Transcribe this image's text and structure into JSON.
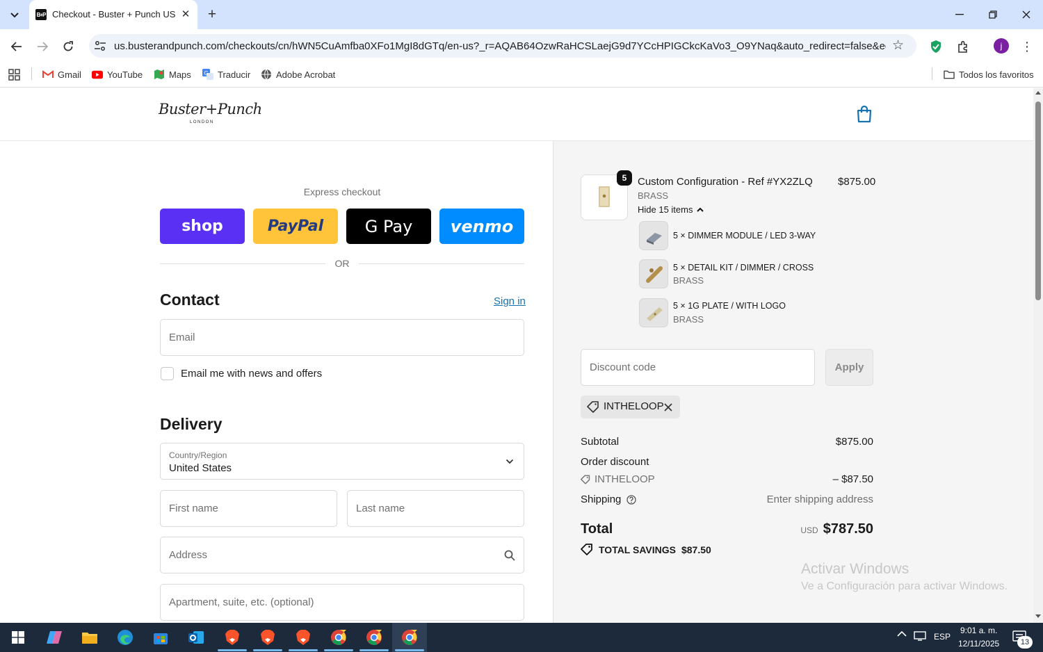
{
  "browser": {
    "tab_title": "Checkout - Buster + Punch US",
    "tab_favicon": "B+P",
    "url": "us.busterandpunch.com/checkouts/cn/hWN5CuAmfba0XFo1MgI8dGTq/en-us?_r=AQAB64OzwRaHCSLaejG9d7YCcHPIGCkcKaVo3_O9YNaq&auto_redirect=false&edge_red...",
    "profile_initial": "j",
    "bookmarks": [
      "Gmail",
      "YouTube",
      "Maps",
      "Traducir",
      "Adobe Acrobat"
    ],
    "all_bookmarks": "Todos los favoritos"
  },
  "brand": {
    "logo_text": "Buster+Punch",
    "logo_sub": "LONDON"
  },
  "checkout": {
    "express_title": "Express checkout",
    "express_buttons": [
      "shop",
      "PayPal",
      "G Pay",
      "venmo"
    ],
    "or": "OR",
    "contact_title": "Contact",
    "sign_in": "Sign in",
    "email_placeholder": "Email",
    "news_label": "Email me with news and offers",
    "delivery_title": "Delivery",
    "country_label": "Country/Region",
    "country_value": "United States",
    "first_name_placeholder": "First name",
    "last_name_placeholder": "Last name",
    "address_placeholder": "Address",
    "apartment_placeholder": "Apartment, suite, etc. (optional)"
  },
  "summary": {
    "item_qty": "5",
    "item_title": "Custom Configuration - Ref #YX2ZLQ",
    "item_sub": "BRASS",
    "item_price": "$875.00",
    "hide_items": "Hide 15 items",
    "components": [
      {
        "label": "5 × DIMMER MODULE / LED 3-WAY",
        "sub": ""
      },
      {
        "label": "5 × DETAIL KIT / DIMMER / CROSS",
        "sub": "BRASS"
      },
      {
        "label": "5 × 1G PLATE / WITH LOGO",
        "sub": "BRASS"
      }
    ],
    "discount_placeholder": "Discount code",
    "apply": "Apply",
    "applied_code": "INTHELOOP",
    "subtotal_label": "Subtotal",
    "subtotal_value": "$875.00",
    "order_discount_label": "Order discount",
    "discount_code": "INTHELOOP",
    "discount_value": "– $87.50",
    "shipping_label": "Shipping",
    "shipping_value": "Enter shipping address",
    "total_label": "Total",
    "total_currency": "USD",
    "total_value": "$787.50",
    "savings_label": "TOTAL SAVINGS",
    "savings_value": "$87.50"
  },
  "watermark": {
    "line1": "Activar Windows",
    "line2": "Ve a Configuración para activar Windows."
  },
  "taskbar": {
    "lang": "ESP",
    "time": "9:01 a. m.",
    "date": "12/11/2025",
    "notifications": "13"
  },
  "colors": {
    "shop": "#5a31f4",
    "paypal": "#ffc439",
    "gpay": "#000000",
    "venmo": "#008cff",
    "link": "#1773b0"
  }
}
